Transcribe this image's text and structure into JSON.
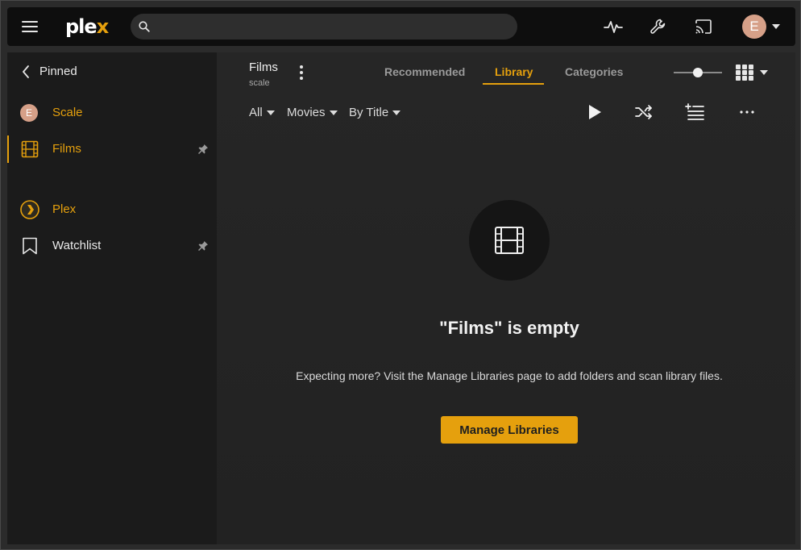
{
  "topbar": {
    "logo_text": "ple",
    "logo_accent": "x",
    "search": {
      "value": "",
      "placeholder": ""
    },
    "icons": [
      "menu-icon",
      "search-icon",
      "activity-icon",
      "wrench-icon",
      "cast-icon"
    ],
    "avatar_letter": "E"
  },
  "sidebar": {
    "pinned_label": "Pinned",
    "items": [
      {
        "label": "Scale",
        "avatar": "E",
        "icon": "avatar"
      },
      {
        "label": "Films",
        "icon": "film-icon",
        "active": true,
        "pinned": true
      },
      {
        "label": "Plex",
        "icon": "plex-icon"
      },
      {
        "label": "Watchlist",
        "icon": "bookmark-icon",
        "pinned": true
      }
    ]
  },
  "library": {
    "title": "Films",
    "subtitle": "scale",
    "tabs": [
      {
        "label": "Recommended",
        "active": false
      },
      {
        "label": "Library",
        "active": true
      },
      {
        "label": "Categories",
        "active": false
      }
    ],
    "filters": [
      "All",
      "Movies",
      "By Title"
    ],
    "actions": [
      "play-icon",
      "shuffle-icon",
      "add-to-queue-icon",
      "more-icon"
    ]
  },
  "empty_state": {
    "title": "\"Films\" is empty",
    "text": "Expecting more? Visit the Manage Libraries page to add folders and scan library files.",
    "button": "Manage Libraries"
  },
  "colors": {
    "accent": "#e5a00d",
    "topbar_bg": "#0e0e0e",
    "sidebar_bg": "#1b1b1b",
    "avatar_bg": "#d6a088"
  }
}
